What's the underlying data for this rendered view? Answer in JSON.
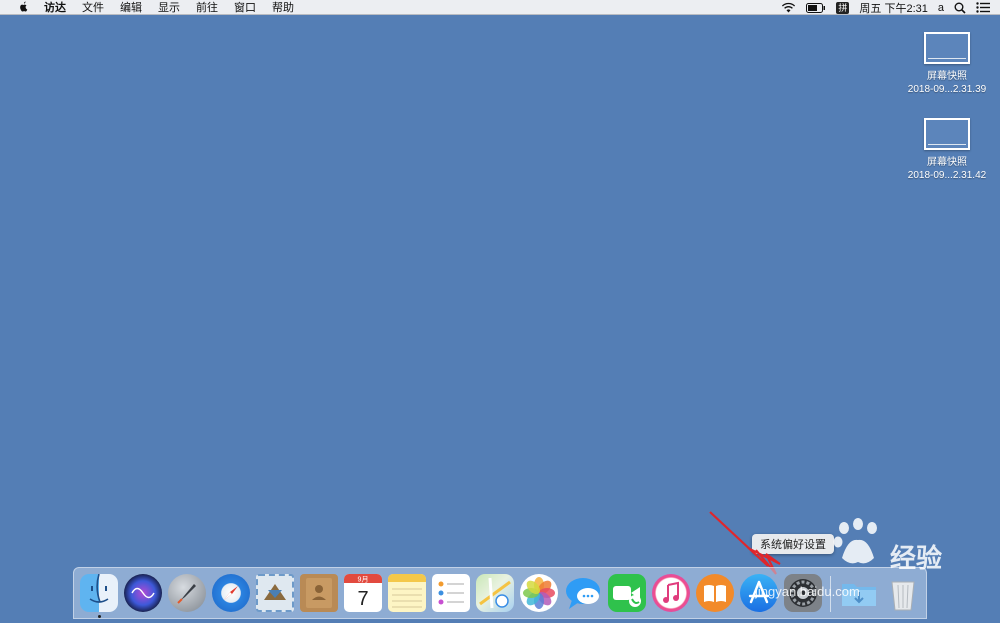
{
  "menubar": {
    "app_name": "访达",
    "items": [
      "文件",
      "编辑",
      "显示",
      "前往",
      "窗口",
      "帮助"
    ],
    "ime_label": "拼",
    "clock": "周五 下午2:31",
    "user": "a"
  },
  "desktop": {
    "icons": [
      {
        "name": "屏幕快照",
        "sub": "2018-09...2.31.39"
      },
      {
        "name": "屏幕快照",
        "sub": "2018-09...2.31.42"
      }
    ]
  },
  "tooltip": {
    "label": "系统偏好设置"
  },
  "calendar": {
    "month": "9月",
    "day": "7"
  },
  "dock": {
    "items": [
      {
        "icon": "finder-icon"
      },
      {
        "icon": "siri-icon"
      },
      {
        "icon": "launchpad-icon"
      },
      {
        "icon": "safari-icon"
      },
      {
        "icon": "mail-icon"
      },
      {
        "icon": "contacts-icon"
      },
      {
        "icon": "calendar-icon"
      },
      {
        "icon": "notes-icon"
      },
      {
        "icon": "reminders-icon"
      },
      {
        "icon": "maps-icon"
      },
      {
        "icon": "photos-icon"
      },
      {
        "icon": "messages-icon"
      },
      {
        "icon": "facetime-icon"
      },
      {
        "icon": "itunes-icon"
      },
      {
        "icon": "ibooks-icon"
      },
      {
        "icon": "app-store-icon"
      },
      {
        "icon": "system-preferences-icon"
      },
      {
        "icon": "downloads-folder-icon"
      },
      {
        "icon": "trash-icon"
      }
    ]
  },
  "watermark": {
    "brand": "经验",
    "url": "jingyan.baidu.com"
  },
  "colors": {
    "desktop": "#547eb5",
    "annotation": "#e0262b"
  }
}
